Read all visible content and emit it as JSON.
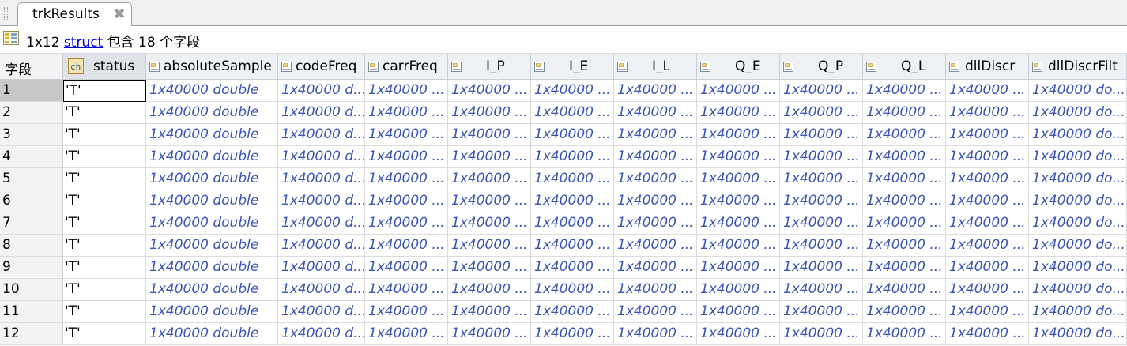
{
  "tab": {
    "title": "trkResults",
    "close_icon": "close-icon"
  },
  "info": {
    "size": "1x12",
    "link": "struct",
    "rest": "包含 18 个字段"
  },
  "table": {
    "corner": "字段",
    "columns": [
      "status",
      "absoluteSample",
      "codeFreq",
      "carrFreq",
      "I_P",
      "I_E",
      "I_L",
      "Q_E",
      "Q_P",
      "Q_L",
      "dllDiscr",
      "dllDiscrFilt"
    ],
    "rows": [
      {
        "n": "1",
        "status": "'T'",
        "vals": [
          "1x40000 double",
          "1x40000 d...",
          "1x40000 ...",
          "1x40000 ...",
          "1x40000 ...",
          "1x40000 ...",
          "1x40000 ...",
          "1x40000 ...",
          "1x40000 ...",
          "1x40000 ...",
          "1x40000 do..."
        ]
      },
      {
        "n": "2",
        "status": "'T'",
        "vals": [
          "1x40000 double",
          "1x40000 d...",
          "1x40000 ...",
          "1x40000 ...",
          "1x40000 ...",
          "1x40000 ...",
          "1x40000 ...",
          "1x40000 ...",
          "1x40000 ...",
          "1x40000 ...",
          "1x40000 do..."
        ]
      },
      {
        "n": "3",
        "status": "'T'",
        "vals": [
          "1x40000 double",
          "1x40000 d...",
          "1x40000 ...",
          "1x40000 ...",
          "1x40000 ...",
          "1x40000 ...",
          "1x40000 ...",
          "1x40000 ...",
          "1x40000 ...",
          "1x40000 ...",
          "1x40000 do..."
        ]
      },
      {
        "n": "4",
        "status": "'T'",
        "vals": [
          "1x40000 double",
          "1x40000 d...",
          "1x40000 ...",
          "1x40000 ...",
          "1x40000 ...",
          "1x40000 ...",
          "1x40000 ...",
          "1x40000 ...",
          "1x40000 ...",
          "1x40000 ...",
          "1x40000 do..."
        ]
      },
      {
        "n": "5",
        "status": "'T'",
        "vals": [
          "1x40000 double",
          "1x40000 d...",
          "1x40000 ...",
          "1x40000 ...",
          "1x40000 ...",
          "1x40000 ...",
          "1x40000 ...",
          "1x40000 ...",
          "1x40000 ...",
          "1x40000 ...",
          "1x40000 do..."
        ]
      },
      {
        "n": "6",
        "status": "'T'",
        "vals": [
          "1x40000 double",
          "1x40000 d...",
          "1x40000 ...",
          "1x40000 ...",
          "1x40000 ...",
          "1x40000 ...",
          "1x40000 ...",
          "1x40000 ...",
          "1x40000 ...",
          "1x40000 ...",
          "1x40000 do..."
        ]
      },
      {
        "n": "7",
        "status": "'T'",
        "vals": [
          "1x40000 double",
          "1x40000 d...",
          "1x40000 ...",
          "1x40000 ...",
          "1x40000 ...",
          "1x40000 ...",
          "1x40000 ...",
          "1x40000 ...",
          "1x40000 ...",
          "1x40000 ...",
          "1x40000 do..."
        ]
      },
      {
        "n": "8",
        "status": "'T'",
        "vals": [
          "1x40000 double",
          "1x40000 d...",
          "1x40000 ...",
          "1x40000 ...",
          "1x40000 ...",
          "1x40000 ...",
          "1x40000 ...",
          "1x40000 ...",
          "1x40000 ...",
          "1x40000 ...",
          "1x40000 do..."
        ]
      },
      {
        "n": "9",
        "status": "'T'",
        "vals": [
          "1x40000 double",
          "1x40000 d...",
          "1x40000 ...",
          "1x40000 ...",
          "1x40000 ...",
          "1x40000 ...",
          "1x40000 ...",
          "1x40000 ...",
          "1x40000 ...",
          "1x40000 ...",
          "1x40000 do..."
        ]
      },
      {
        "n": "10",
        "status": "'T'",
        "vals": [
          "1x40000 double",
          "1x40000 d...",
          "1x40000 ...",
          "1x40000 ...",
          "1x40000 ...",
          "1x40000 ...",
          "1x40000 ...",
          "1x40000 ...",
          "1x40000 ...",
          "1x40000 ...",
          "1x40000 do..."
        ]
      },
      {
        "n": "11",
        "status": "'T'",
        "vals": [
          "1x40000 double",
          "1x40000 d...",
          "1x40000 ...",
          "1x40000 ...",
          "1x40000 ...",
          "1x40000 ...",
          "1x40000 ...",
          "1x40000 ...",
          "1x40000 ...",
          "1x40000 ...",
          "1x40000 do..."
        ]
      },
      {
        "n": "12",
        "status": "'T'",
        "vals": [
          "1x40000 double",
          "1x40000 d...",
          "1x40000 ...",
          "1x40000 ...",
          "1x40000 ...",
          "1x40000 ...",
          "1x40000 ...",
          "1x40000 ...",
          "1x40000 ...",
          "1x40000 ...",
          "1x40000 do..."
        ]
      }
    ],
    "selected_row": 1
  },
  "colors": {
    "value_text": "#3a55b3",
    "link": "#0000ee",
    "header_bg": "#eef1f4"
  }
}
